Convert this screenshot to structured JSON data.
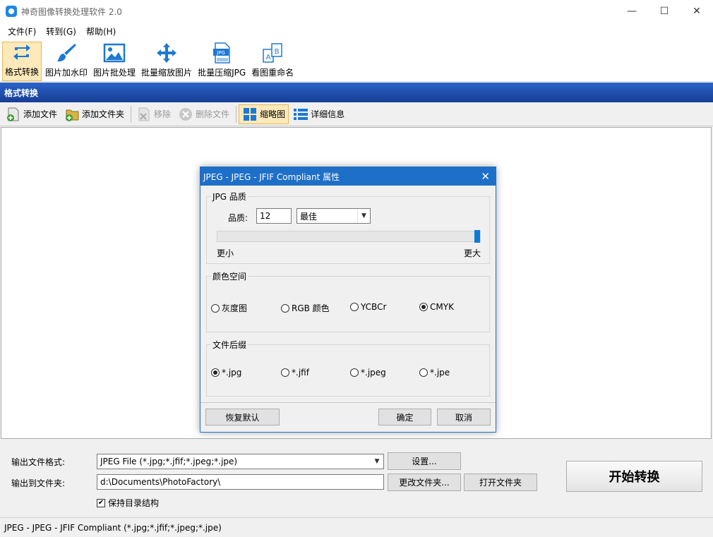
{
  "window": {
    "title": "神奇图像转换处理软件 2.0",
    "minimize": "—",
    "maximize": "☐",
    "close": "✕"
  },
  "menu": [
    "文件(F)",
    "转到(G)",
    "帮助(H)"
  ],
  "toolbar": [
    {
      "label": "格式转换",
      "icon": "convert-icon"
    },
    {
      "label": "图片加水印",
      "icon": "brush-icon"
    },
    {
      "label": "图片批处理",
      "icon": "image-icon"
    },
    {
      "label": "批量缩放图片",
      "icon": "move-arrows-icon"
    },
    {
      "label": "批量压缩JPG",
      "icon": "jpg-file-icon",
      "icon_text": "JPG"
    },
    {
      "label": "看图重命名",
      "icon": "rename-icon"
    }
  ],
  "section_title": "格式转换",
  "subtoolbar": {
    "add_file": "添加文件",
    "add_folder": "添加文件夹",
    "remove": "移除",
    "delete_file": "删除文件",
    "thumbnail": "缩略图",
    "details": "详细信息"
  },
  "dialog": {
    "title": "JPEG - JPEG - JFIF Compliant 属性",
    "quality_group": "JPG 品质",
    "quality_label": "品质:",
    "quality_value": "12",
    "quality_preset": "最佳",
    "slider_min": "更小",
    "slider_max": "更大",
    "slider_fraction": 1.0,
    "colorspace_group": "颜色空间",
    "colorspace_options": [
      "灰度图",
      "RGB 颜色",
      "YCBCr",
      "CMYK"
    ],
    "colorspace_selected": "CMYK",
    "suffix_group": "文件后缀",
    "suffix_options": [
      "*.jpg",
      "*.jfif",
      "*.jpeg",
      "*.jpe"
    ],
    "suffix_selected": "*.jpg",
    "reset_button": "恢复默认",
    "ok_button": "确定",
    "cancel_button": "取消"
  },
  "output": {
    "format_label": "输出文件格式:",
    "format_value": "JPEG File (*.jpg;*.jfif;*.jpeg;*.jpe)",
    "settings_button": "设置...",
    "folder_label": "输出到文件夹:",
    "folder_value": "d:\\Documents\\PhotoFactory\\",
    "change_folder_button": "更改文件夹...",
    "open_folder_button": "打开文件夹",
    "keep_structure": "保持目录结构",
    "keep_structure_checked": true,
    "start_button": "开始转换"
  },
  "status": "JPEG - JPEG - JFIF Compliant (*.jpg;*.jfif;*.jpeg;*.jpe)",
  "colors": {
    "accent": "#1e6fc8",
    "section_header": "#1e4ea8",
    "active_tool": "#fde9b9",
    "slider_thumb": "#0a7ad8"
  }
}
